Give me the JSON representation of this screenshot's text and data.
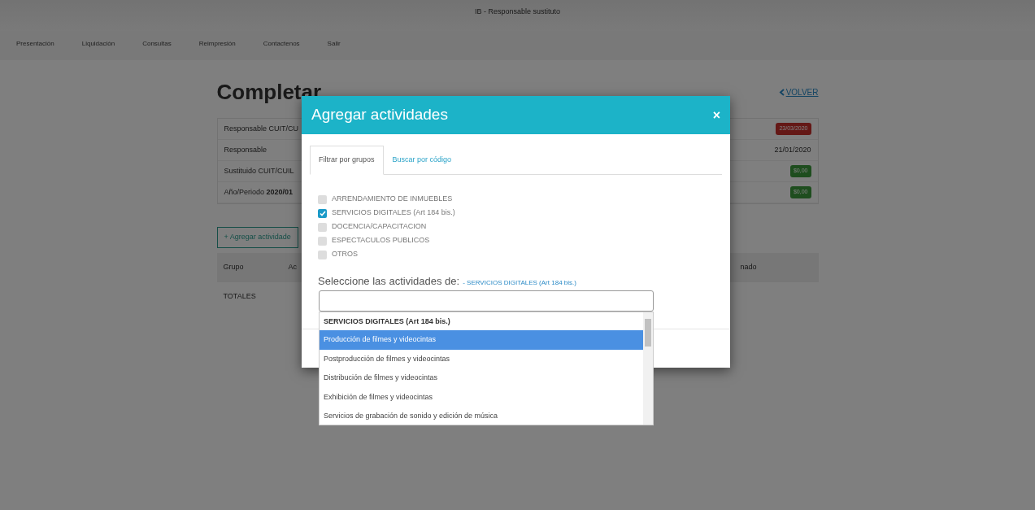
{
  "window": {
    "title": "IB - Responsable sustituto"
  },
  "menu": [
    "Presentación",
    "Liquidación",
    "Consultas",
    "Reimpresión",
    "Contactenos",
    "Salir"
  ],
  "page": {
    "heading": "Completar",
    "back_link": "VOLVER",
    "details": [
      {
        "label": "Responsable CUIT/CU"
      },
      {
        "label": "Responsable"
      },
      {
        "label": "Sustituido CUIT/CUIL"
      },
      {
        "label": "Año/Periodo **2020/01**"
      }
    ],
    "values": [
      {
        "text": "23/03/2020",
        "kind": "danger"
      },
      {
        "text": "21/01/2020",
        "kind": "plain"
      },
      {
        "text": "$0,00",
        "kind": "success"
      },
      {
        "text": "$0,00",
        "kind": "success"
      }
    ],
    "add_button": "+ Agregar actividade",
    "table": {
      "columns": [
        "Grupo",
        "Ac",
        "nado"
      ],
      "rows": [
        [
          "TOTALES"
        ]
      ]
    }
  },
  "modal": {
    "title": "Agregar actividades",
    "close": "×",
    "tabs": [
      {
        "label": "Filtrar por grupos",
        "selected": true
      },
      {
        "label": "Buscar por código",
        "selected": false
      }
    ],
    "groups": [
      {
        "label": "ARRENDAMIENTO DE INMUEBLES",
        "checked": false
      },
      {
        "label": "SERVICIOS DIGITALES (Art 184 bis.)",
        "checked": true
      },
      {
        "label": "DOCENCIA/CAPACITACION",
        "checked": false
      },
      {
        "label": "ESPECTACULOS PUBLICOS",
        "checked": false
      },
      {
        "label": "OTROS",
        "checked": false
      }
    ],
    "select_label": "Seleccione las actividades de:",
    "select_group": "- SERVICIOS DIGITALES (Art 184 bis.)",
    "dropdown": {
      "group_header": "SERVICIOS DIGITALES (Art 184 bis.)",
      "options": [
        {
          "label": "Producción de filmes y videocintas",
          "selected": true
        },
        {
          "label": "Postproducción de filmes y videocintas",
          "selected": false
        },
        {
          "label": "Distribución de filmes y videocintas",
          "selected": false
        },
        {
          "label": "Exhibición de filmes y videocintas",
          "selected": false
        },
        {
          "label": "Servicios de grabación de sonido y edición de música",
          "selected": false
        }
      ]
    }
  }
}
